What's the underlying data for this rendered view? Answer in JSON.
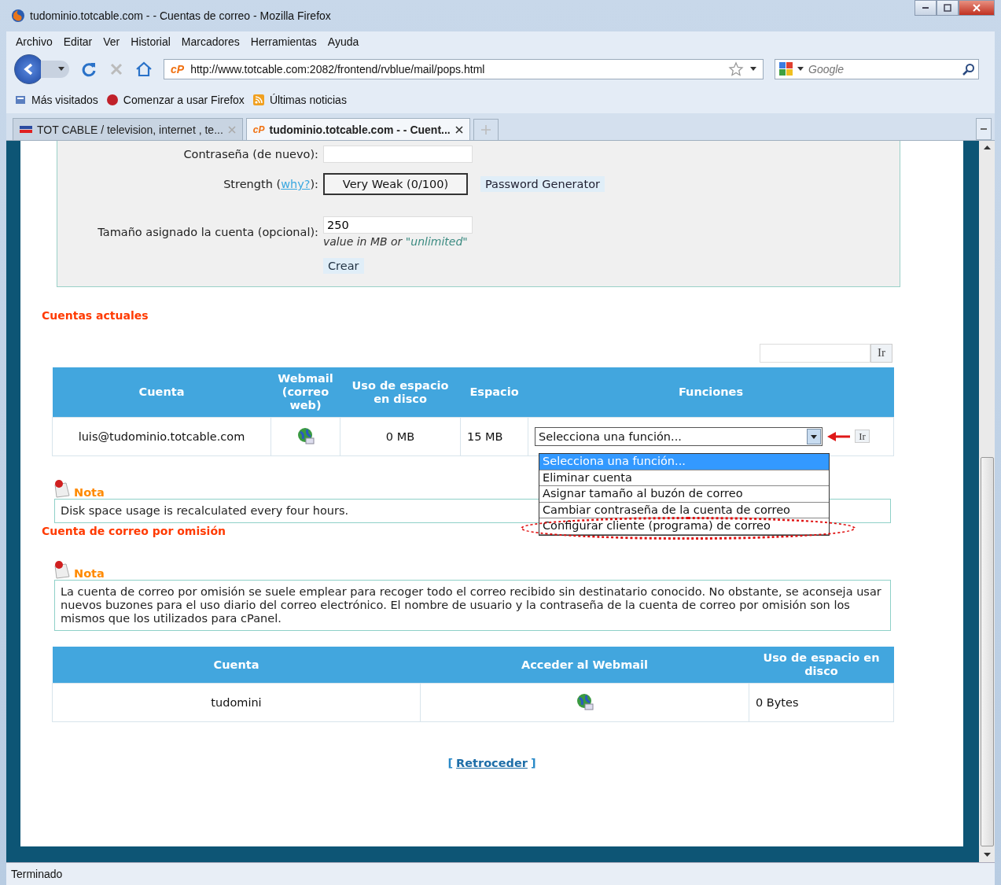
{
  "window": {
    "title": "tudominio.totcable.com - - Cuentas de correo - Mozilla Firefox"
  },
  "menu": [
    "Archivo",
    "Editar",
    "Ver",
    "Historial",
    "Marcadores",
    "Herramientas",
    "Ayuda"
  ],
  "toolbar": {
    "site_icon": "cP",
    "url": "http://www.totcable.com:2082/frontend/rvblue/mail/pops.html",
    "search": {
      "placeholder": "Google"
    }
  },
  "bookmarks": [
    {
      "label": "Más visitados",
      "kind": "folder"
    },
    {
      "label": "Comenzar a usar Firefox",
      "kind": "page"
    },
    {
      "label": "Últimas noticias",
      "kind": "feed"
    }
  ],
  "tabs": [
    {
      "label": "TOT CABLE / television, internet , te...",
      "selected": false
    },
    {
      "label": "tudominio.totcable.com - - Cuent...",
      "selected": true,
      "icon_text": "cP"
    }
  ],
  "form": {
    "password_again": {
      "label": "Contraseña (de nuevo):"
    },
    "strength": {
      "label_start": "Strength (",
      "link": "why?",
      "label_end": "):",
      "meter": "Very Weak (0/100)",
      "generator_button": "Password Generator"
    },
    "quota": {
      "label": "Tamaño asignado la cuenta (opcional):",
      "value": "250",
      "hint": "value in MB or ",
      "hint_value": "\"unlimited\""
    },
    "create_button": "Crear"
  },
  "accounts": {
    "title": "Cuentas actuales",
    "go_button": "Ir",
    "columns": [
      "Cuenta",
      "Webmail (correo web)",
      "Uso de espacio en disco",
      "Espacio",
      "Funciones"
    ],
    "rows": [
      {
        "account": "luis@tudominio.totcable.com",
        "usage": "0 MB",
        "quota": "15 MB",
        "function": "Selecciona una función...",
        "go_button": "Ir"
      }
    ],
    "dropdown": {
      "options": [
        {
          "label": "Selecciona una función...",
          "selected": true,
          "circled": false
        },
        {
          "label": "Eliminar cuenta",
          "selected": false,
          "circled": false
        },
        {
          "label": "Asignar tamaño al buzón de correo",
          "selected": false,
          "circled": false
        },
        {
          "label": "Cambiar contraseña de la cuenta de correo",
          "selected": false,
          "circled": false
        },
        {
          "label": "Configurar cliente (programa) de correo",
          "selected": false,
          "circled": true
        }
      ]
    },
    "note": {
      "title": "Nota",
      "text": "Disk space usage is recalculated every four hours."
    }
  },
  "default_account": {
    "title": "Cuenta de correo por omisión",
    "note": {
      "title": "Nota",
      "text": "La cuenta de correo por omisión se suele emplear para recoger todo el correo recibido sin destinatario conocido. No obstante, se aconseja usar nuevos buzones para el uso diario del correo electrónico. El nombre de usuario y la contraseña de la cuenta de correo por omisión son los mismos que los utilizados para cPanel."
    },
    "columns": [
      "Cuenta",
      "Acceder al Webmail",
      "Uso de espacio en disco"
    ],
    "rows": [
      {
        "account": "tudomini",
        "usage": "0 Bytes"
      }
    ]
  },
  "back_link": {
    "open": "[",
    "label": "Retroceder",
    "close": "]"
  },
  "status_bar": {
    "text": "Terminado"
  }
}
